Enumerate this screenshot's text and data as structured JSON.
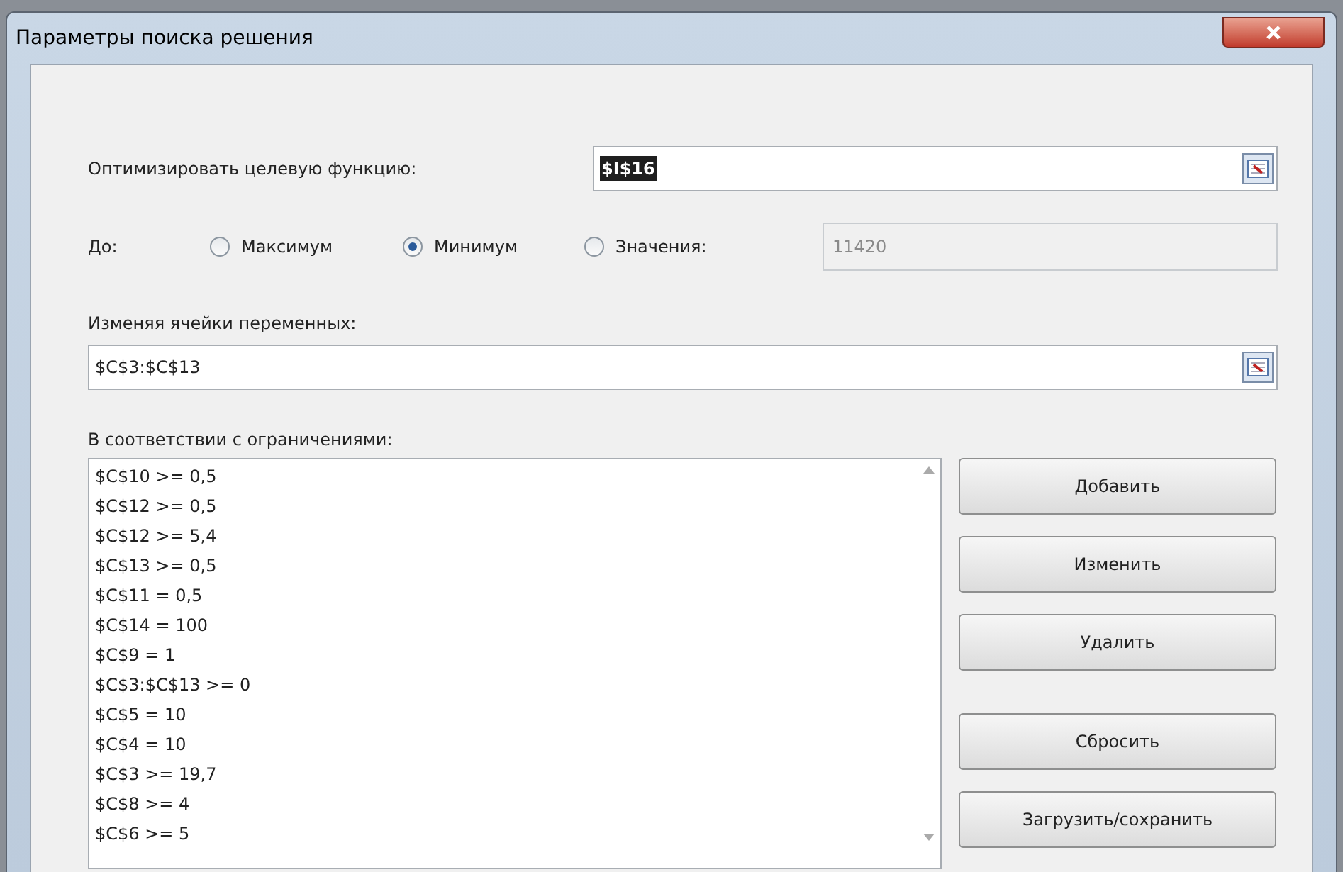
{
  "window": {
    "title": "Параметры поиска решения"
  },
  "objective": {
    "label": "Оптимизировать целевую функцию:",
    "value": "$I$16",
    "selected_text": true
  },
  "to": {
    "label": "До:",
    "options": [
      {
        "label": "Максимум",
        "selected": false
      },
      {
        "label": "Минимум",
        "selected": true
      },
      {
        "label": "Значения:",
        "selected": false
      }
    ],
    "value_field": {
      "value": "11420",
      "disabled": true
    }
  },
  "variables": {
    "label": "Изменяя ячейки переменных:",
    "value": "$C$3:$C$13"
  },
  "constraints": {
    "label": "В соответствии с ограничениями:",
    "items": [
      "$C$10 >= 0,5",
      "$C$12 >= 0,5",
      "$C$12 >= 5,4",
      "$C$13 >= 0,5",
      "$C$11 = 0,5",
      "$C$14 = 100",
      "$C$9 = 1",
      "$C$3:$C$13 >= 0",
      "$C$5 = 10",
      "$C$4 = 10",
      "$C$3 >= 19,7",
      "$C$8 >= 4",
      "$C$6 >= 5"
    ]
  },
  "button_groups": [
    [
      "Добавить",
      "Изменить",
      "Удалить"
    ],
    [
      "Сбросить",
      "Загрузить/сохранить"
    ]
  ]
}
